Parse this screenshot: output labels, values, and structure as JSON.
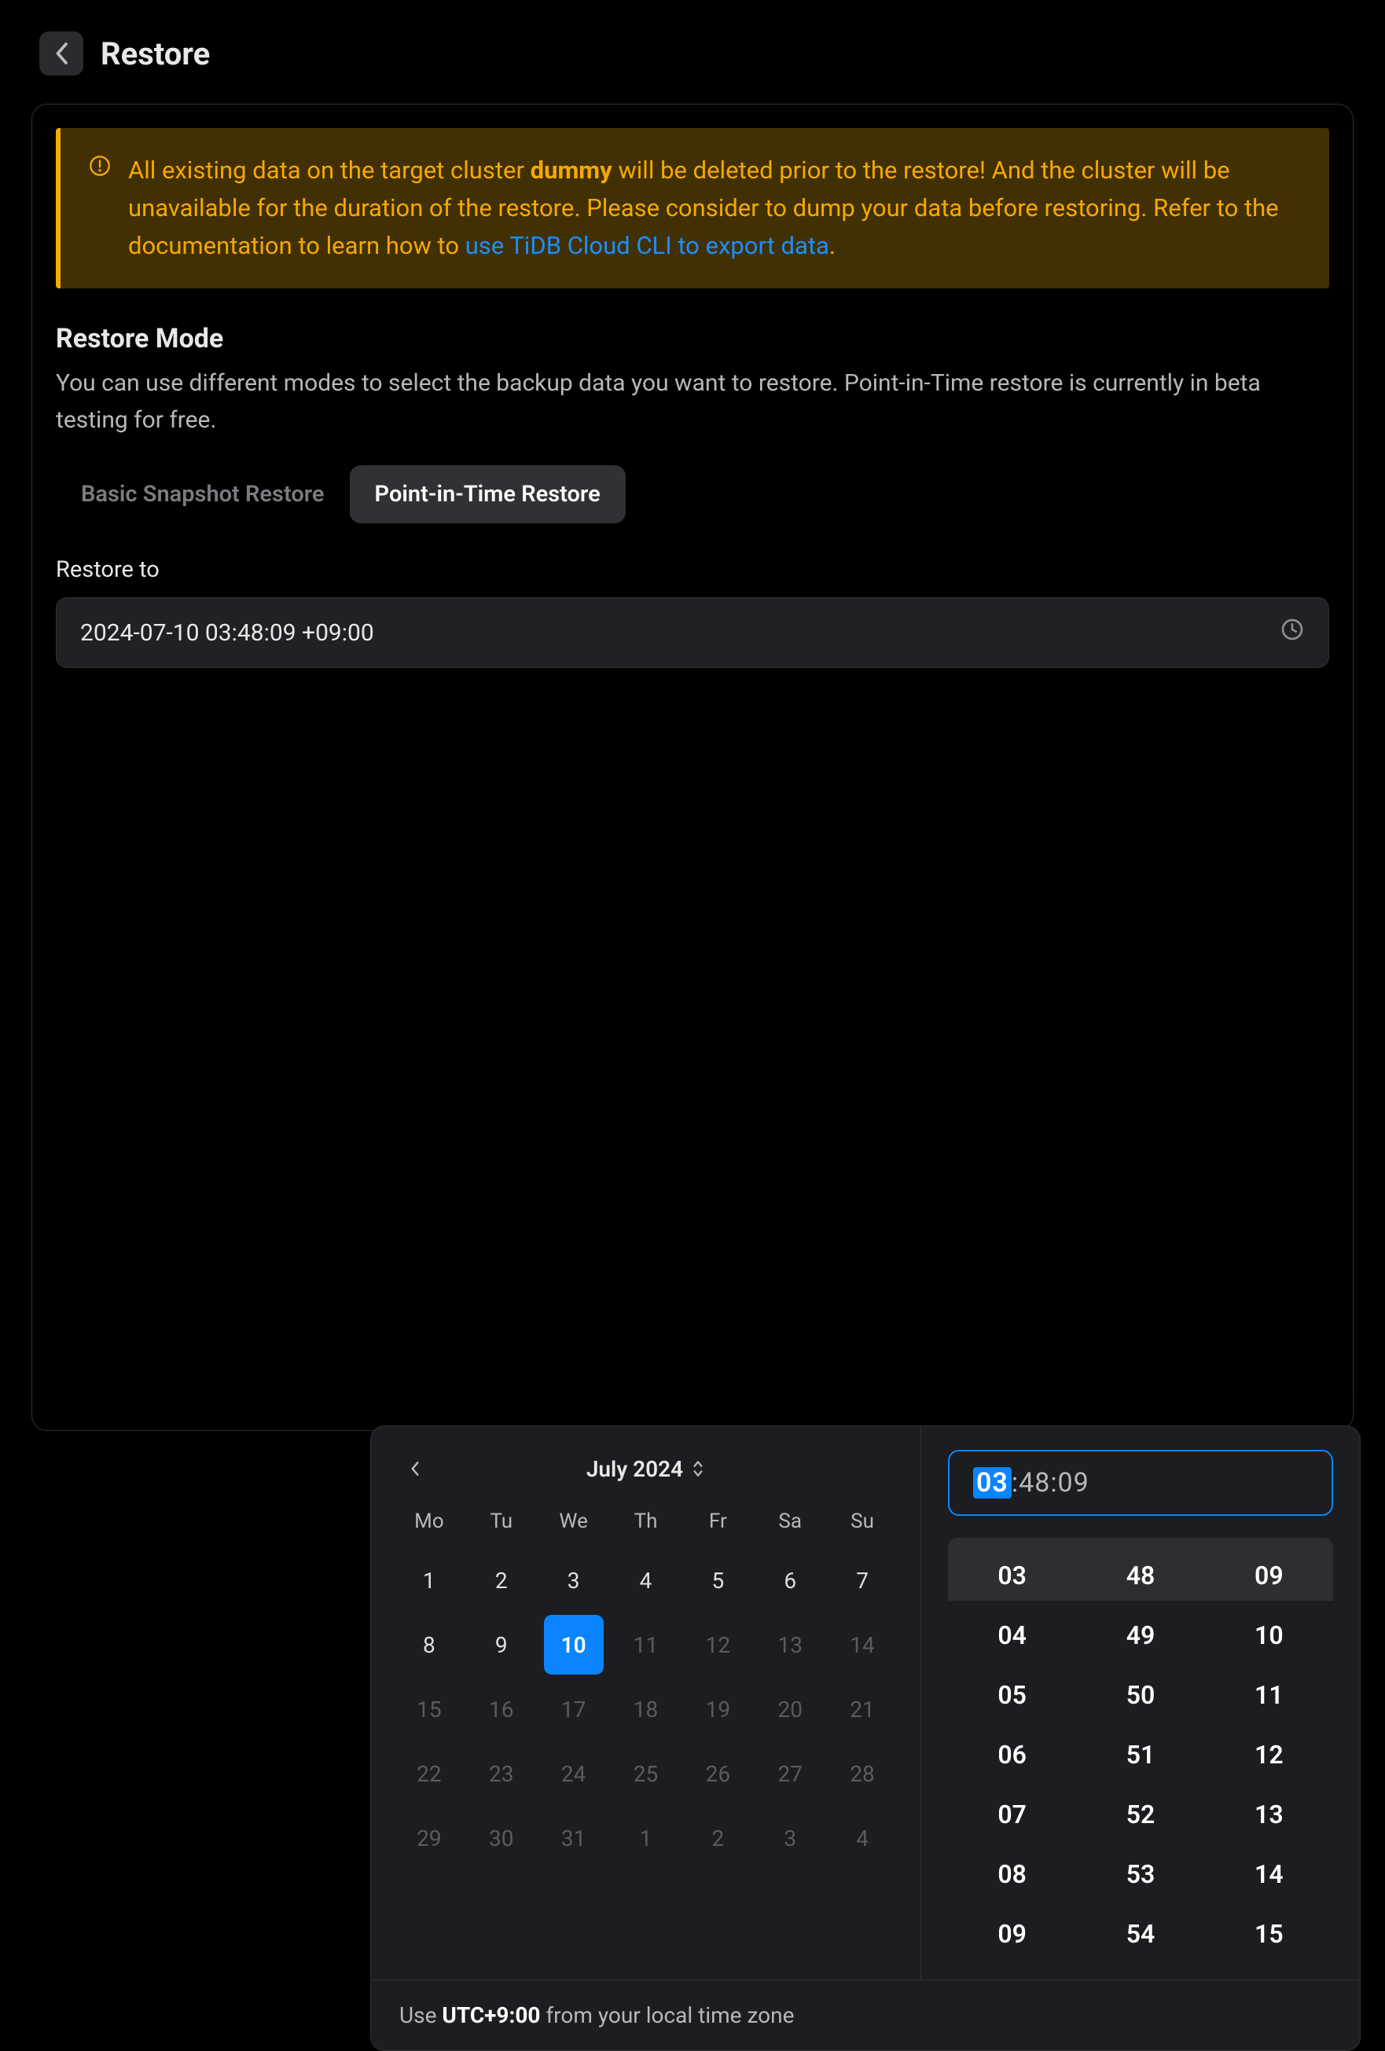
{
  "page": {
    "title": "Restore"
  },
  "alert": {
    "pre": "All existing data on the target cluster ",
    "cluster_name": "dummy",
    "mid": " will be deleted prior to the restore! And the cluster will be unavailable for the duration of the restore. Please consider to dump your data before restoring. Refer to the documentation to learn how to ",
    "link_text": "use TiDB Cloud CLI to export data",
    "post": "."
  },
  "restoreMode": {
    "title": "Restore Mode",
    "subtitle": "You can use different modes to select the backup data you want to restore. Point-in-Time restore is currently in beta testing for free.",
    "options": {
      "basic": "Basic Snapshot Restore",
      "pit": "Point-in-Time Restore"
    }
  },
  "restoreTo": {
    "label": "Restore to",
    "value": "2024-07-10 03:48:09 +09:00"
  },
  "calendar": {
    "month_label": "July 2024",
    "dow": [
      "Mo",
      "Tu",
      "We",
      "Th",
      "Fr",
      "Sa",
      "Su"
    ],
    "days": [
      {
        "d": "1"
      },
      {
        "d": "2"
      },
      {
        "d": "3"
      },
      {
        "d": "4"
      },
      {
        "d": "5"
      },
      {
        "d": "6"
      },
      {
        "d": "7"
      },
      {
        "d": "8"
      },
      {
        "d": "9"
      },
      {
        "d": "10",
        "sel": true
      },
      {
        "d": "11",
        "muted": true
      },
      {
        "d": "12",
        "muted": true
      },
      {
        "d": "13",
        "muted": true
      },
      {
        "d": "14",
        "muted": true
      },
      {
        "d": "15",
        "muted": true
      },
      {
        "d": "16",
        "muted": true
      },
      {
        "d": "17",
        "muted": true
      },
      {
        "d": "18",
        "muted": true
      },
      {
        "d": "19",
        "muted": true
      },
      {
        "d": "20",
        "muted": true
      },
      {
        "d": "21",
        "muted": true
      },
      {
        "d": "22",
        "muted": true
      },
      {
        "d": "23",
        "muted": true
      },
      {
        "d": "24",
        "muted": true
      },
      {
        "d": "25",
        "muted": true
      },
      {
        "d": "26",
        "muted": true
      },
      {
        "d": "27",
        "muted": true
      },
      {
        "d": "28",
        "muted": true
      },
      {
        "d": "29",
        "muted": true
      },
      {
        "d": "30",
        "muted": true
      },
      {
        "d": "31",
        "muted": true
      },
      {
        "d": "1",
        "muted": true
      },
      {
        "d": "2",
        "muted": true
      },
      {
        "d": "3",
        "muted": true
      },
      {
        "d": "4",
        "muted": true
      }
    ]
  },
  "time": {
    "hh": "03",
    "mm": "48",
    "ss": "09",
    "colon": " : ",
    "hours": [
      "03",
      "04",
      "05",
      "06",
      "07",
      "08",
      "09"
    ],
    "minutes": [
      "48",
      "49",
      "50",
      "51",
      "52",
      "53",
      "54"
    ],
    "seconds": [
      "09",
      "10",
      "11",
      "12",
      "13",
      "14",
      "15"
    ]
  },
  "tz": {
    "prefix": "Use ",
    "value": "UTC+9:00",
    "suffix": " from your local time zone"
  }
}
